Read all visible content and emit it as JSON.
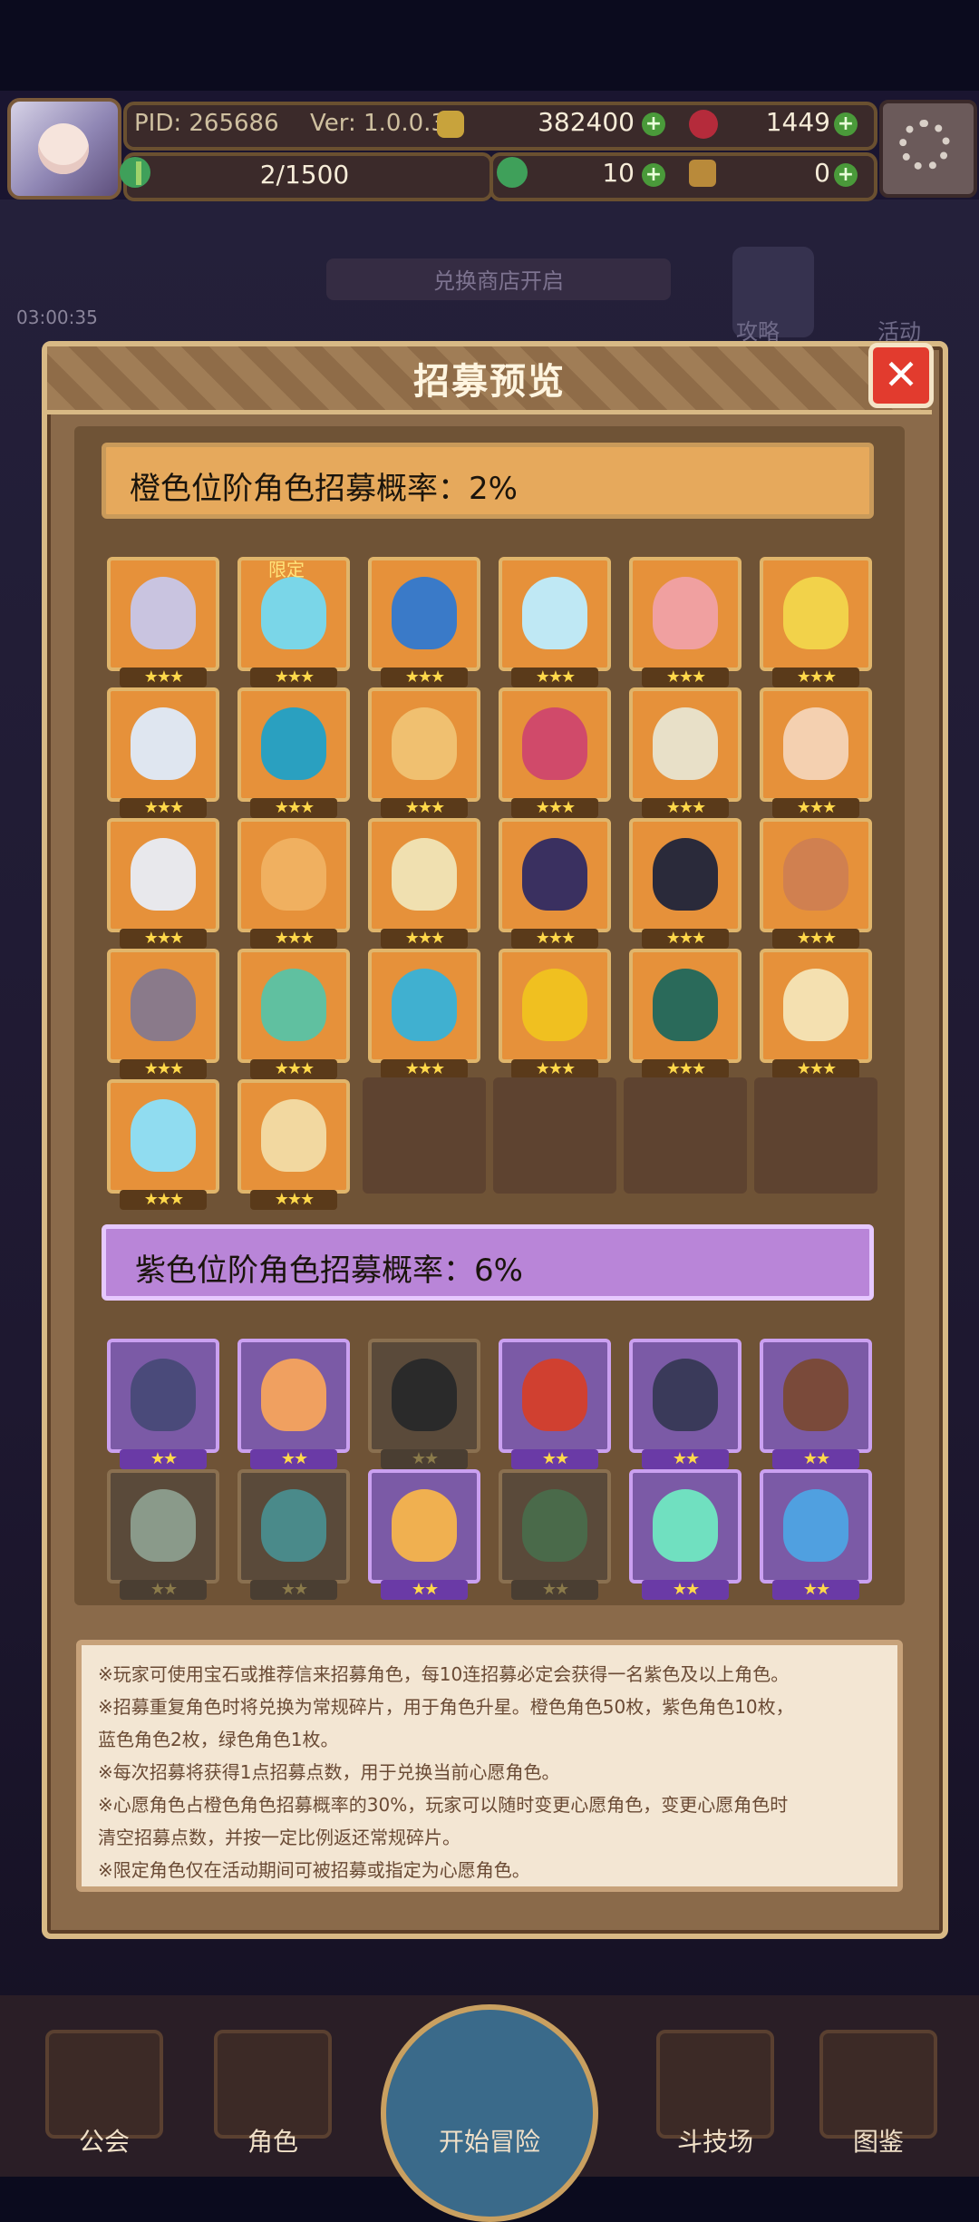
{
  "topbar": {
    "pid": "PID: 265686",
    "version": "Ver: 1.0.0.3",
    "gold": "382400",
    "gems": "1449",
    "xp": "2/1500",
    "clover": "10",
    "bag": "0"
  },
  "background": {
    "sign": "兑换商店开启",
    "timer": "03:00:35",
    "guide": "攻略",
    "event": "活动"
  },
  "modal": {
    "title": "招募预览",
    "orange_label": "橙色位阶角色招募概率：2%",
    "purple_label": "紫色位阶角色招募概率：6%",
    "limited_tag": "限定"
  },
  "orange_cards": [
    {
      "face": "#c9c4e0",
      "stars": "★★★"
    },
    {
      "face": "#7ad6e8",
      "stars": "★★★"
    },
    {
      "face": "#3a7ac8",
      "stars": "★★★"
    },
    {
      "face": "#bfe8f4",
      "stars": "★★★"
    },
    {
      "face": "#f0a0a0",
      "stars": "★★★"
    },
    {
      "face": "#f2d24a",
      "stars": "★★★"
    },
    {
      "face": "#dfe6f0",
      "stars": "★★★"
    },
    {
      "face": "#2aa0c0",
      "stars": "★★★"
    },
    {
      "face": "#f0c070",
      "stars": "★★★"
    },
    {
      "face": "#d04a6a",
      "stars": "★★★"
    },
    {
      "face": "#e8e0c8",
      "stars": "★★★"
    },
    {
      "face": "#f4d0b0",
      "stars": "★★★"
    },
    {
      "face": "#e8e8ec",
      "stars": "★★★"
    },
    {
      "face": "#f0b060",
      "stars": "★★★"
    },
    {
      "face": "#f0e0b0",
      "stars": "★★★"
    },
    {
      "face": "#3a3060",
      "stars": "★★★"
    },
    {
      "face": "#2a2a3a",
      "stars": "★★★"
    },
    {
      "face": "#d08050",
      "stars": "★★★"
    },
    {
      "face": "#8a7a8a",
      "stars": "★★★"
    },
    {
      "face": "#60c0a0",
      "stars": "★★★"
    },
    {
      "face": "#40b0d0",
      "stars": "★★★"
    },
    {
      "face": "#f0c020",
      "stars": "★★★"
    },
    {
      "face": "#2a6a5a",
      "stars": "★★★"
    },
    {
      "face": "#f4e0b0",
      "stars": "★★★"
    },
    {
      "face": "#90dcf0",
      "stars": "★★★"
    },
    {
      "face": "#f2d8a0",
      "stars": "★★★"
    }
  ],
  "purple_cards": [
    {
      "face": "#4a4a7a",
      "stars": "★★",
      "state": "p"
    },
    {
      "face": "#f0a060",
      "stars": "★★",
      "state": "p"
    },
    {
      "face": "#2a2a2a",
      "stars": "★★",
      "state": "g"
    },
    {
      "face": "#d04030",
      "stars": "★★",
      "state": "p"
    },
    {
      "face": "#3a3a5a",
      "stars": "★★",
      "state": "p"
    },
    {
      "face": "#7a4a3a",
      "stars": "★★",
      "state": "p"
    },
    {
      "face": "#8a9a8a",
      "stars": "★★",
      "state": "g"
    },
    {
      "face": "#4a8a8a",
      "stars": "★★",
      "state": "g"
    },
    {
      "face": "#f0b050",
      "stars": "★★",
      "state": "p"
    },
    {
      "face": "#4a6a4a",
      "stars": "★★",
      "state": "g"
    },
    {
      "face": "#70e0c0",
      "stars": "★★",
      "state": "p"
    },
    {
      "face": "#50a0e0",
      "stars": "★★",
      "state": "p"
    }
  ],
  "description": [
    "※玩家可使用宝石或推荐信来招募角色，每10连招募必定会获得一名紫色及以上角色。",
    "※招募重复角色时将兑换为常规碎片，用于角色升星。橙色角色50枚，紫色角色10枚，",
    "蓝色角色2枚，绿色角色1枚。",
    "※每次招募将获得1点招募点数，用于兑换当前心愿角色。",
    "※心愿角色占橙色角色招募概率的30%，玩家可以随时变更心愿角色，变更心愿角色时",
    "清空招募点数，并按一定比例返还常规碎片。",
    "※限定角色仅在活动期间可被招募或指定为心愿角色。"
  ],
  "nav": {
    "guild": "公会",
    "character": "角色",
    "adventure": "开始冒险",
    "arena": "斗技场",
    "codex": "图鉴"
  },
  "colors": {
    "accent_orange": "#e6a95c",
    "accent_purple": "#b985d8",
    "close_red": "#e23b2e"
  }
}
